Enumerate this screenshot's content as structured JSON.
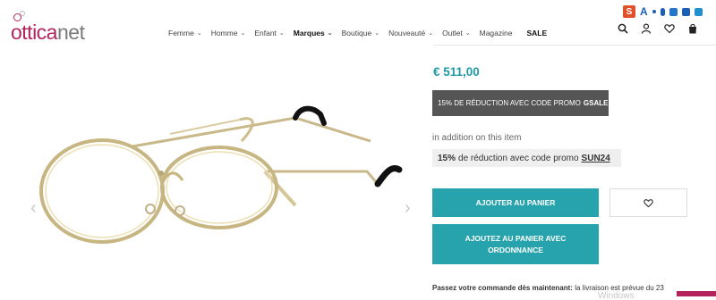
{
  "header": {
    "logo_colored": "ottica",
    "logo_gray": "net",
    "nav": [
      {
        "label": "Femme",
        "chevron": true,
        "bold": false
      },
      {
        "label": "Homme",
        "chevron": true,
        "bold": false
      },
      {
        "label": "Enfant",
        "chevron": true,
        "bold": false
      },
      {
        "label": "Marques",
        "chevron": true,
        "bold": true
      },
      {
        "label": "Boutique",
        "chevron": true,
        "bold": false
      },
      {
        "label": "Nouveauté",
        "chevron": true,
        "bold": false
      },
      {
        "label": "Outlet",
        "chevron": true,
        "bold": false
      },
      {
        "label": "Magazine",
        "chevron": false,
        "bold": false
      },
      {
        "label": "SALE",
        "chevron": false,
        "bold": true
      }
    ],
    "icons": [
      "search-icon",
      "user-icon",
      "heart-icon",
      "bag-icon"
    ],
    "extension": {
      "s": "S",
      "a": "A"
    }
  },
  "product": {
    "price": "€ 511,00",
    "promo_dark_text": "15% DE RÉDUCTION AVEC CODE PROMO",
    "promo_dark_code": "GSALE",
    "addition_text": "in addition on this item",
    "promo_light_pct": "15%",
    "promo_light_text": "de réduction avec code promo",
    "promo_light_code": "SUN24",
    "add_to_cart": "AJOUTER AU PANIER",
    "add_with_rx": "AJOUTEZ AU PANIER AVEC ORDONNANCE",
    "delivery_bold": "Passez votre commande dès maintenant:",
    "delivery_text": "la livraison est prévue du 23",
    "watermark": "Windows"
  },
  "colors": {
    "brand": "#b3245d",
    "accent": "#27a3ad",
    "price": "#1f9aa6",
    "promo_dark_bg": "#555555"
  }
}
